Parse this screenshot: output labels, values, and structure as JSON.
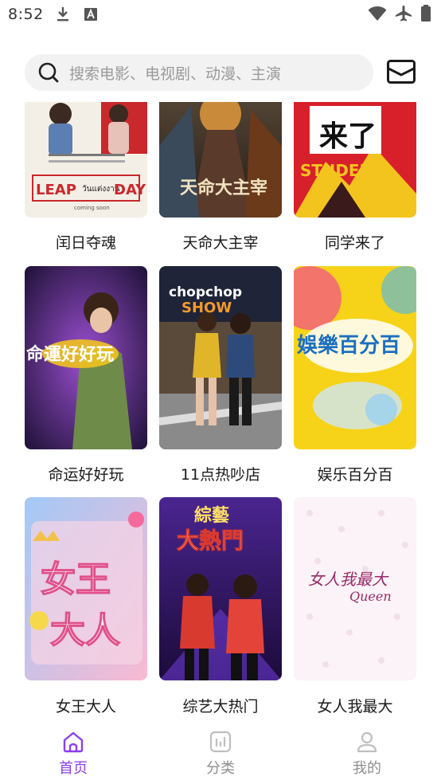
{
  "status_bar": {
    "time": "8:52",
    "left_icons": [
      "download-icon",
      "text-a-icon"
    ],
    "right_icons": [
      "wifi-icon",
      "airplane-icon",
      "battery-icon"
    ]
  },
  "search": {
    "placeholder": "搜索电影、电视剧、动漫、主演"
  },
  "header": {
    "mail_icon": "mail-icon"
  },
  "grid": {
    "items": [
      {
        "title": "闰日夺魂",
        "poster_lines": [
          "LEAP",
          "วันแต่งงาน",
          "DAY",
          "coming soon"
        ],
        "colors": [
          "#f4efe6",
          "#c9282d"
        ]
      },
      {
        "title": "天命大主宰",
        "poster_lines": [
          "天命大主宰"
        ],
        "colors": [
          "#3b2b25",
          "#c98a3a"
        ]
      },
      {
        "title": "同学来了",
        "poster_lines": [
          "来了",
          "STUDENT"
        ],
        "colors": [
          "#d8202a",
          "#f3c41d"
        ]
      },
      {
        "title": "命运好好玩",
        "poster_lines": [
          "命運好好玩"
        ],
        "colors": [
          "#2b1a4f",
          "#7e3db0"
        ]
      },
      {
        "title": "11点热吵店",
        "poster_lines": [
          "chopchop",
          "SHOW"
        ],
        "colors": [
          "#1f2438",
          "#b48a4a"
        ]
      },
      {
        "title": "娱乐百分百",
        "poster_lines": [
          "娛樂百分百"
        ],
        "colors": [
          "#f6d318",
          "#f24b8f"
        ]
      },
      {
        "title": "女王大人",
        "poster_lines": [
          "女王",
          "大人"
        ],
        "colors": [
          "#f9b9d2",
          "#a3c9f7"
        ]
      },
      {
        "title": "综艺大热门",
        "poster_lines": [
          "綜藝",
          "大熱門"
        ],
        "colors": [
          "#3b1a6e",
          "#d93a2f"
        ]
      },
      {
        "title": "女人我最大",
        "poster_lines": [
          "女人我最大",
          "Queen"
        ],
        "colors": [
          "#fbf3f7",
          "#9a2a6a"
        ]
      }
    ]
  },
  "bottom_nav": {
    "items": [
      {
        "label": "首页",
        "icon": "home-icon",
        "active": true
      },
      {
        "label": "分类",
        "icon": "category-icon",
        "active": false
      },
      {
        "label": "我的",
        "icon": "profile-icon",
        "active": false
      }
    ],
    "active_color": "#8a3ff1",
    "inactive_color": "#8e8e8e"
  }
}
